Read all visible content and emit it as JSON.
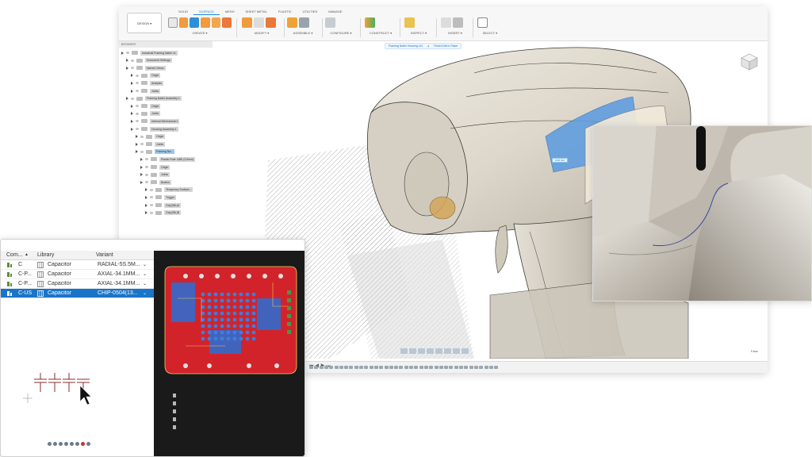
{
  "cad": {
    "workspace_button": "DESIGN ▾",
    "tabs": [
      {
        "label": "SOLID",
        "active": false
      },
      {
        "label": "SURFACE",
        "active": true
      },
      {
        "label": "MESH",
        "active": false
      },
      {
        "label": "SHEET METAL",
        "active": false
      },
      {
        "label": "PLASTIC",
        "active": false
      },
      {
        "label": "UTILITIES",
        "active": false
      },
      {
        "label": "MANAGE",
        "active": false
      }
    ],
    "tool_groups": [
      {
        "label": "CREATE ▾"
      },
      {
        "label": "MODIFY ▾"
      },
      {
        "label": "ASSEMBLE ▾"
      },
      {
        "label": "CONFIGURE ▾"
      },
      {
        "label": "CONSTRUCT ▾"
      },
      {
        "label": "INSPECT ▾"
      },
      {
        "label": "INSERT ▾"
      },
      {
        "label": "SELECT ▾"
      }
    ],
    "browser": {
      "header": "BROWSER",
      "items": [
        {
          "label": "Industrial Framing Nailer v1",
          "indent": 0
        },
        {
          "label": "Document Settings",
          "indent": 1
        },
        {
          "label": "Named Views",
          "indent": 1
        },
        {
          "label": "Origin",
          "indent": 2
        },
        {
          "label": "Analysis",
          "indent": 2
        },
        {
          "label": "Joints",
          "indent": 2
        },
        {
          "label": "Framing Nailer Assembly:1",
          "indent": 1
        },
        {
          "label": "Origin",
          "indent": 2
        },
        {
          "label": "Joints",
          "indent": 2
        },
        {
          "label": "Internal Mechanical:1",
          "indent": 2
        },
        {
          "label": "Housing Assembly:1",
          "indent": 2
        },
        {
          "label": "Origin",
          "indent": 3
        },
        {
          "label": "Joints",
          "indent": 3
        },
        {
          "label": "Framing Na...",
          "indent": 3,
          "selected": true
        },
        {
          "label": "Plastic Rule: ABS (3.0mm)",
          "indent": 4
        },
        {
          "label": "Origin",
          "indent": 4
        },
        {
          "label": "Joints",
          "indent": 4
        },
        {
          "label": "Bodies",
          "indent": 4
        },
        {
          "label": "Temporary Surface...",
          "indent": 5
        },
        {
          "label": "Trigger",
          "indent": 5
        },
        {
          "label": "Grip(38L)A",
          "indent": 5
        },
        {
          "label": "Grip(38L)B",
          "indent": 5
        }
      ]
    },
    "edit_bar": {
      "component": "Framing Nailer Housing v11",
      "finish": "Finish Edit In Place"
    },
    "dimension_tag": "0.00 mm",
    "status_face": "Face"
  },
  "electronics": {
    "columns": [
      "Com...",
      "Library",
      "Variant"
    ],
    "rows": [
      {
        "component": "C",
        "library": "Capacitor",
        "variant": "RADIAL-5S.5M...",
        "selected": false
      },
      {
        "component": "C-P...",
        "library": "Capacitor",
        "variant": "AXIAL-34.1MM...",
        "selected": false
      },
      {
        "component": "C-P...",
        "library": "Capacitor",
        "variant": "AXIAL-34.1MM...",
        "selected": false
      },
      {
        "component": "C-US",
        "library": "Capacitor",
        "variant": "CHIP-0504(13...",
        "selected": true
      }
    ]
  },
  "colors": {
    "accent": "#1a8ad6",
    "selection": "#1a75c8",
    "pcb_red": "#d2232a",
    "pcb_blue": "#2a6fd6",
    "cad_body": "#e0dbd0"
  }
}
